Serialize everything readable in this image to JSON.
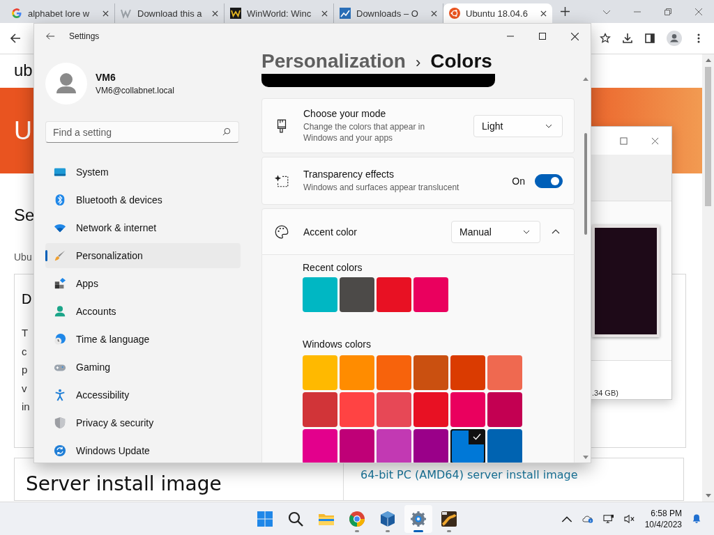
{
  "browser": {
    "tabs": [
      {
        "title": "alphabet lore w",
        "kind": "google",
        "selected": false
      },
      {
        "title": "Download this a",
        "kind": "wiki",
        "selected": false
      },
      {
        "title": "WinWorld: Winc",
        "kind": "winworld",
        "selected": false
      },
      {
        "title": "Downloads – O",
        "kind": "chart",
        "selected": false
      },
      {
        "title": "Ubuntu 18.04.6",
        "kind": "ubuntu",
        "selected": true
      }
    ]
  },
  "page": {
    "logo": "ub",
    "banner_text": "U",
    "heading": "Se",
    "subtitle": "Ubu",
    "card": {
      "title": "D",
      "lines": [
        "T",
        "c",
        "p",
        "v",
        "in"
      ]
    },
    "bottom_card": {
      "title": "Server install image",
      "link": "64-bit PC (AMD64) server install image"
    }
  },
  "background_window": {
    "size_text": ".34 GB)"
  },
  "settings": {
    "title": "Settings",
    "user": {
      "name": "VM6",
      "email": "VM6@collabnet.local"
    },
    "search": {
      "placeholder": "Find a setting"
    },
    "nav": [
      {
        "label": "System",
        "kind": "system",
        "selected": false
      },
      {
        "label": "Bluetooth & devices",
        "kind": "bluetooth",
        "selected": false
      },
      {
        "label": "Network & internet",
        "kind": "network",
        "selected": false
      },
      {
        "label": "Personalization",
        "kind": "brush",
        "selected": true
      },
      {
        "label": "Apps",
        "kind": "apps",
        "selected": false
      },
      {
        "label": "Accounts",
        "kind": "accounts",
        "selected": false
      },
      {
        "label": "Time & language",
        "kind": "time",
        "selected": false
      },
      {
        "label": "Gaming",
        "kind": "gaming",
        "selected": false
      },
      {
        "label": "Accessibility",
        "kind": "accessibility",
        "selected": false
      },
      {
        "label": "Privacy & security",
        "kind": "privacy",
        "selected": false
      },
      {
        "label": "Windows Update",
        "kind": "update",
        "selected": false
      }
    ],
    "breadcrumb": {
      "parent": "Personalization",
      "separator": "›",
      "current": "Colors"
    },
    "mode": {
      "title": "Choose your mode",
      "description": "Change the colors that appear in Windows and your apps",
      "value": "Light"
    },
    "transparency": {
      "title": "Transparency effects",
      "description": "Windows and surfaces appear translucent",
      "state_label": "On",
      "on": true
    },
    "accent": {
      "title": "Accent color",
      "value": "Manual",
      "expanded": true,
      "recent_label": "Recent colors",
      "recent": [
        {
          "color": "#00b7c3"
        },
        {
          "color": "#4c4a48"
        },
        {
          "color": "#e81123"
        },
        {
          "color": "#ea005e"
        }
      ],
      "windows_label": "Windows colors",
      "windows_colors": [
        {
          "color": "#ffb900",
          "selected": false
        },
        {
          "color": "#ff8c00",
          "selected": false
        },
        {
          "color": "#f7630c",
          "selected": false
        },
        {
          "color": "#ca5010",
          "selected": false
        },
        {
          "color": "#da3b01",
          "selected": false
        },
        {
          "color": "#ef6950",
          "selected": false
        },
        {
          "color": "#d13438",
          "selected": false
        },
        {
          "color": "#ff4343",
          "selected": false
        },
        {
          "color": "#e74856",
          "selected": false
        },
        {
          "color": "#e81123",
          "selected": false
        },
        {
          "color": "#ea005e",
          "selected": false
        },
        {
          "color": "#c30052",
          "selected": false
        },
        {
          "color": "#e3008c",
          "selected": false
        },
        {
          "color": "#bf0077",
          "selected": false
        },
        {
          "color": "#c239b3",
          "selected": false
        },
        {
          "color": "#9a0089",
          "selected": false
        },
        {
          "color": "#0078d7",
          "selected": true
        },
        {
          "color": "#0063b1",
          "selected": false
        }
      ]
    }
  },
  "taskbar": {
    "apps": [
      {
        "kind": "start",
        "selected": false,
        "running": false
      },
      {
        "kind": "search",
        "selected": false,
        "running": false
      },
      {
        "kind": "explorer",
        "selected": false,
        "running": false
      },
      {
        "kind": "chrome",
        "selected": false,
        "running": true
      },
      {
        "kind": "virtualbox",
        "selected": false,
        "running": true
      },
      {
        "kind": "settings",
        "selected": true,
        "running": true
      },
      {
        "kind": "app",
        "selected": false,
        "running": true
      }
    ],
    "time": "6:58 PM",
    "date": "10/4/2023"
  }
}
